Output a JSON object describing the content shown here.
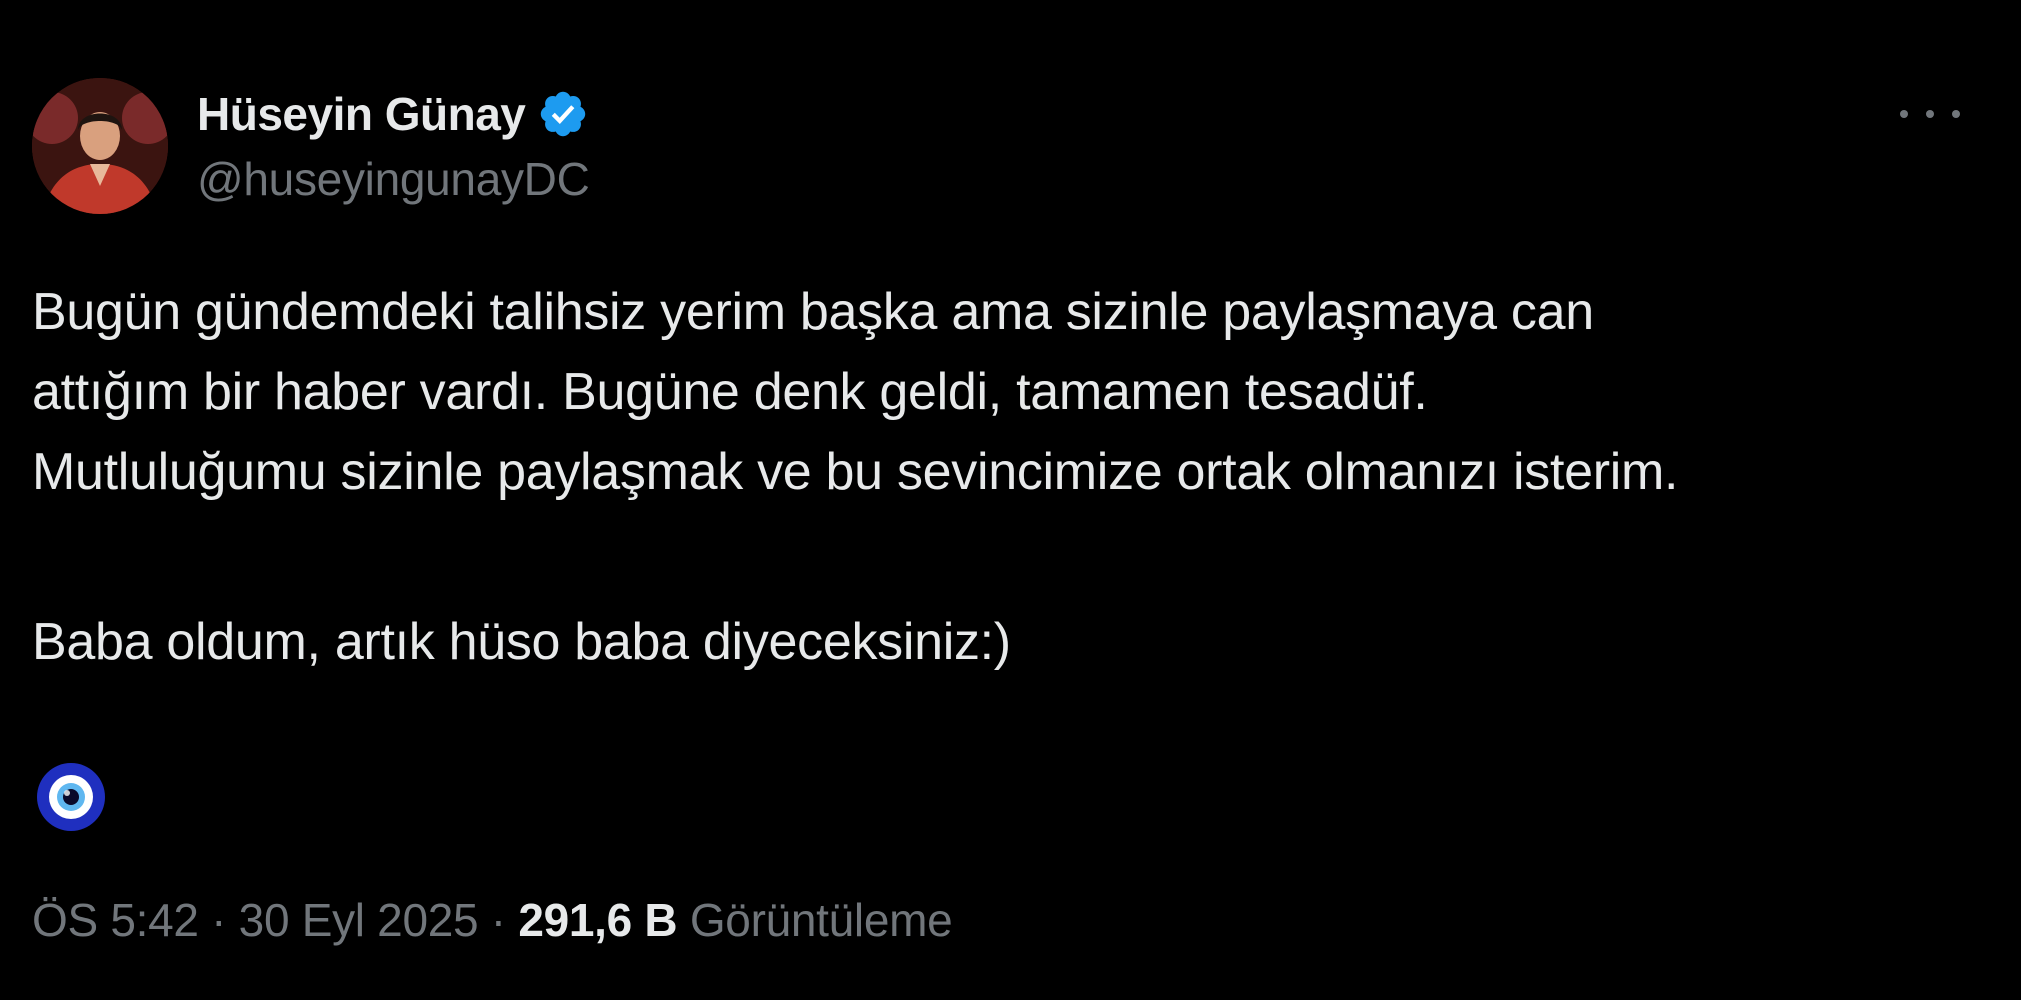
{
  "author": {
    "display_name": "Hüseyin Günay",
    "handle": "@huseyingunayDC",
    "verified": true,
    "verified_color": "#1d9bf0"
  },
  "tweet": {
    "lines": [
      "Bugün gündemdeki talihsiz yerim başka ama sizinle paylaşmaya can",
      "attığım bir haber vardı. Bugüne denk geldi, tamamen tesadüf.",
      "Mutluluğumu sizinle paylaşmak ve bu sevincimize ortak olmanızı isterim.",
      "Baba oldum, artık hüso baba diyeceksiniz:)"
    ],
    "emoji": "nazar-amulet-icon"
  },
  "meta": {
    "time": "ÖS 5:42",
    "separator": " · ",
    "date": "30 Eyl 2025",
    "views_count": "291,6 B",
    "views_label": "Görüntüleme"
  },
  "colors": {
    "background": "#000000",
    "text": "#e7e9ea",
    "muted": "#71767b"
  }
}
